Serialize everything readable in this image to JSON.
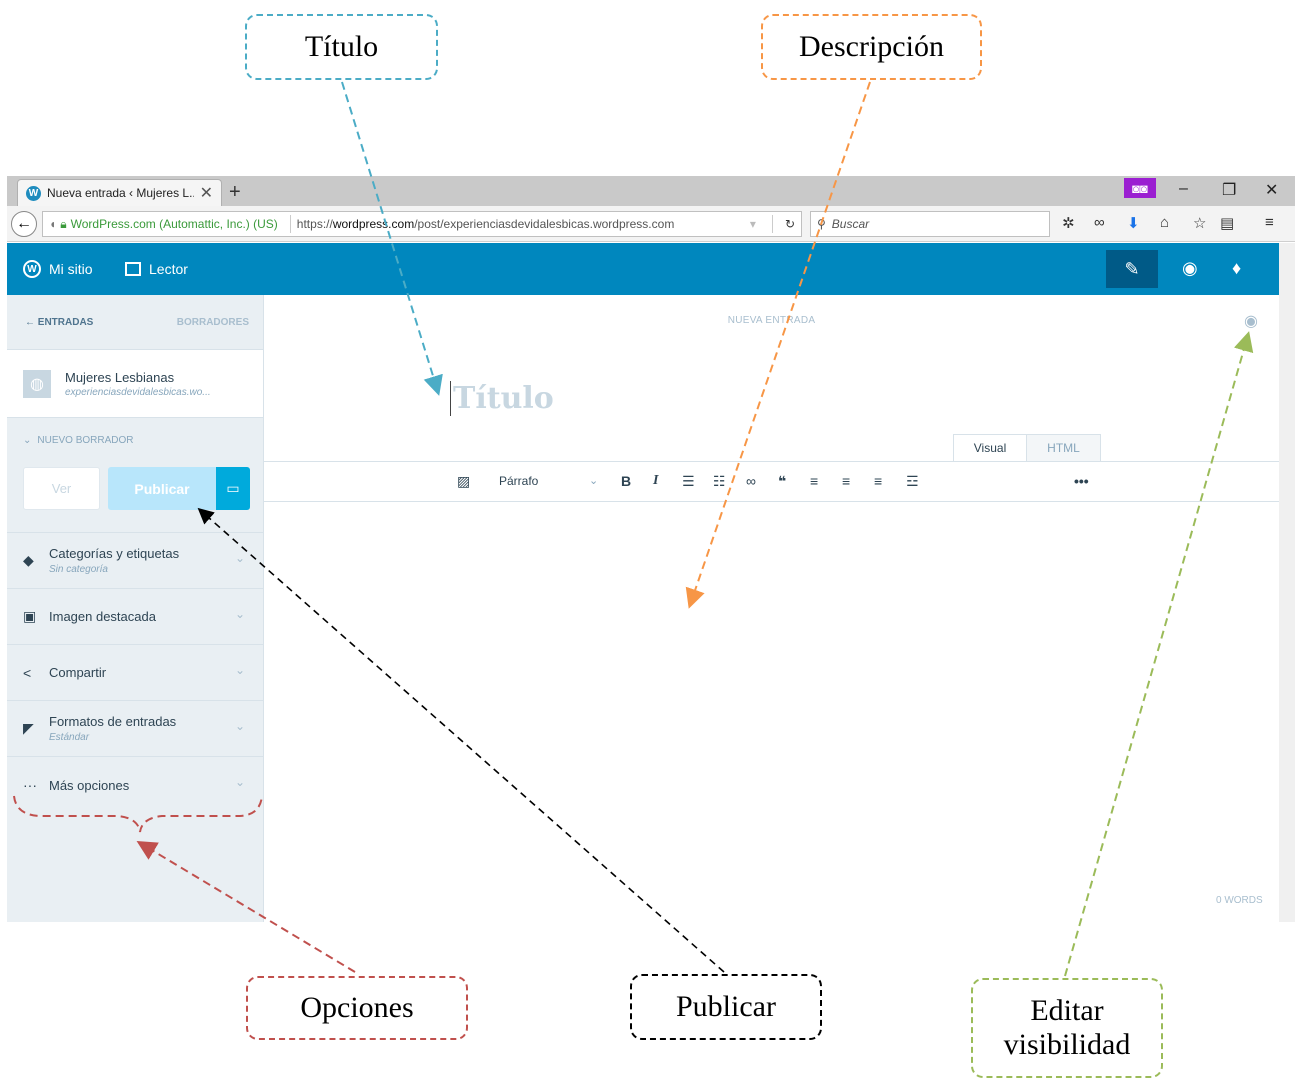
{
  "annotations": {
    "titulo": "Título",
    "descripcion": "Descripción",
    "opciones": "Opciones",
    "publicar": "Publicar",
    "visibilidad": "Editar visibilidad",
    "colors": {
      "titulo": "#4bacc6",
      "descripcion": "#f79646",
      "opciones": "#c0504d",
      "publicar": "#000000",
      "visibilidad": "#9bbb59"
    }
  },
  "browser": {
    "tab_title": "Nueva entrada ‹ Mujeres L...",
    "identity": "WordPress.com (Automattic, Inc.) (US)",
    "url_prefix": "https://",
    "url_domain": "wordpress.com",
    "url_path": "/post/experienciasdevidalesbicas.wordpress.com",
    "search_placeholder": "Buscar"
  },
  "masterbar": {
    "my_site": "Mi sitio",
    "reader": "Lector",
    "brand_color": "#0087be"
  },
  "sidebar": {
    "back_label": "← ENTRADAS",
    "drafts_label": "BORRADORES",
    "site_name": "Mujeres Lesbianas",
    "site_url": "experienciasdevidalesbicas.wo...",
    "new_draft": "NUEVO BORRADOR",
    "view_button": "Ver",
    "publish_button": "Publicar",
    "sections": [
      {
        "icon": "tag-icon",
        "title": "Categorías y etiquetas",
        "subtitle": "Sin categoría"
      },
      {
        "icon": "image-icon",
        "title": "Imagen destacada",
        "subtitle": ""
      },
      {
        "icon": "share-icon",
        "title": "Compartir",
        "subtitle": ""
      },
      {
        "icon": "formats-icon",
        "title": "Formatos de entradas",
        "subtitle": "Estándar"
      },
      {
        "icon": "ellipsis-icon",
        "title": "Más opciones",
        "subtitle": ""
      }
    ]
  },
  "editor": {
    "header": "NUEVA ENTRADA",
    "title_placeholder": "Título",
    "tab_visual": "Visual",
    "tab_html": "HTML",
    "format_select": "Párrafo",
    "word_count": "0 WORDS"
  }
}
